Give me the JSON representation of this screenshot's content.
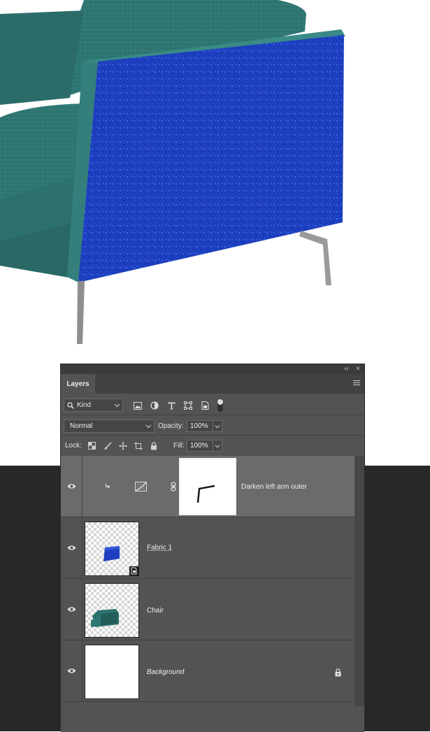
{
  "canvas": {
    "artwork": "armchair-with-blue-fabric-arm",
    "chair_color": "#2f7773",
    "fabric_color": "#1d3fbf",
    "leg_color": "#9a9a9a",
    "lower_background": "#282828"
  },
  "panel": {
    "collapse_glyph": "‹‹",
    "close_glyph": "×",
    "tab_label": "Layers",
    "menu_icon": "panel-menu-icon",
    "filter": {
      "search_icon": "search-icon",
      "kind_label": "Kind",
      "icons": [
        "pixel-filter-icon",
        "adjustment-filter-icon",
        "type-filter-icon",
        "shape-filter-icon",
        "smart-object-filter-icon"
      ],
      "filter_toggle": "on"
    },
    "blend": {
      "mode": "Normal",
      "opacity_label": "Opacity:",
      "opacity_value": "100%"
    },
    "lock": {
      "label": "Lock:",
      "icons": [
        "lock-transparent-pixels-icon",
        "lock-image-pixels-icon",
        "lock-position-icon",
        "lock-artboard-icon",
        "lock-all-icon"
      ],
      "fill_label": "Fill:",
      "fill_value": "100%"
    },
    "layers": [
      {
        "name": "Darken  left arm  outer",
        "type": "adjustment-with-mask",
        "selected": true,
        "clipped": true,
        "visible": true
      },
      {
        "name": "Fabric 1",
        "type": "smart-object",
        "selected": false,
        "visible": true
      },
      {
        "name": "Chair",
        "type": "pixel",
        "selected": false,
        "visible": true
      },
      {
        "name": "Background",
        "type": "background",
        "selected": false,
        "visible": true,
        "locked": true
      }
    ]
  }
}
